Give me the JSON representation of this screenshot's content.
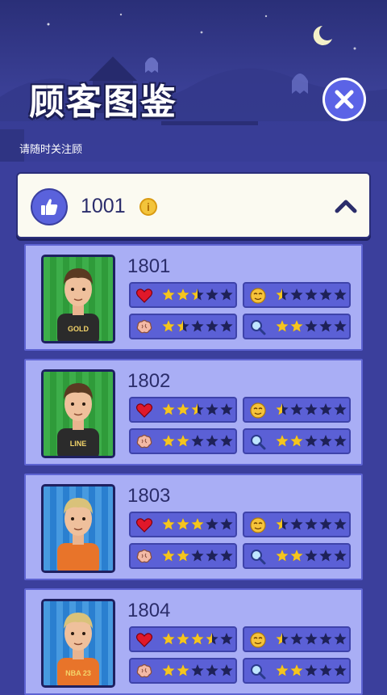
{
  "header": {
    "title": "顾客图鉴",
    "subtitle": "请随时关注顾"
  },
  "category": {
    "id": "1001"
  },
  "icons": {
    "close": "close-icon",
    "like": "thumbs-up-icon",
    "info": "info-icon",
    "collapse": "chevron-up-icon",
    "stat_types": [
      "heart-icon",
      "smile-face-icon",
      "brain-icon",
      "magnifier-icon"
    ]
  },
  "colors": {
    "background": "#3b3f9c",
    "card": "#a9aef5",
    "stat_box": "#5b60d6",
    "star_filled": "#f5c51f",
    "star_empty": "#1e2158",
    "close_button": "#5b63e6"
  },
  "customers": [
    {
      "id": "1801",
      "shirt_text": "GOLD",
      "portrait_bg": "green",
      "ratings": {
        "heart": 2.5,
        "mood": 0.5,
        "brain": 1.5,
        "search": 2
      }
    },
    {
      "id": "1802",
      "shirt_text": "LINE",
      "portrait_bg": "green",
      "ratings": {
        "heart": 2.5,
        "mood": 0.5,
        "brain": 2,
        "search": 2
      }
    },
    {
      "id": "1803",
      "shirt_text": "",
      "portrait_bg": "blue",
      "ratings": {
        "heart": 3,
        "mood": 0.5,
        "brain": 2,
        "search": 2
      }
    },
    {
      "id": "1804",
      "shirt_text": "NBA 23",
      "portrait_bg": "blue",
      "ratings": {
        "heart": 3.5,
        "mood": 0.5,
        "brain": 2,
        "search": 2
      }
    }
  ]
}
